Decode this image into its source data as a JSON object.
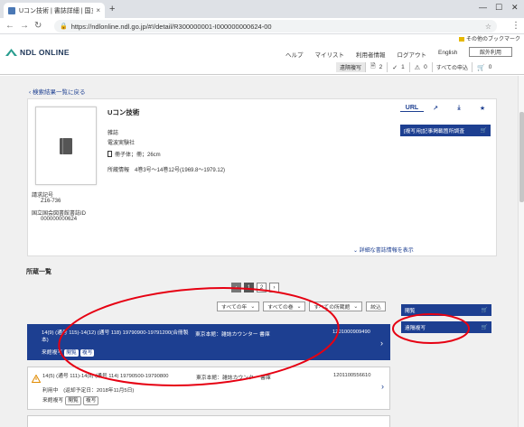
{
  "browser": {
    "tab_title": "Uコン技術 | 書誌詳細 | 国立国会",
    "tab_close": "×",
    "new_tab": "+",
    "url": "https://ndlonline.ndl.go.jp/#!/detail/R300000001-I000000000624-00",
    "bookmark_other": "その他のブックマーク",
    "win_min": "—",
    "win_max": "☐",
    "win_close": "✕"
  },
  "header": {
    "logo_text": "NDL ONLINE",
    "nav": [
      "ヘルプ",
      "マイリスト",
      "利用者情報",
      "ログアウト",
      "English"
    ],
    "remote_button": "館外利用",
    "copy_request": "遠隔複写",
    "copy_count": "2",
    "check_count": "1",
    "warn_count": "0",
    "all_requests": "すべての申込",
    "cart_count": "0"
  },
  "main": {
    "back_link": "検索結果一覧に戻る",
    "title": "Uコン技術",
    "type": "雑誌",
    "publisher": "電波実験社",
    "format": "冊子体；冊；26cm",
    "holdings_info": "所蔵情報　4巻3号～14巻12号(1969.8～1979.12)",
    "call_number_label": "請求記号",
    "call_number": "Z16-736",
    "bib_id_label": "国立国会図書館書誌ID",
    "bib_id": "000000000624",
    "more_link": "詳細な書誌情報を表示",
    "actions": {
      "url": "URL",
      "external": "↗",
      "download": "⤓",
      "star": "★"
    },
    "copy_survey": "[複写用]記事掲載箇所調査"
  },
  "holdings": {
    "label": "所蔵一覧",
    "pages": [
      "1",
      "2"
    ],
    "current_page": "1",
    "filters": [
      "すべての年",
      "すべての巻",
      "すべての所蔵館"
    ],
    "narrow_button": "絞込",
    "rows": [
      {
        "volume": "14(9) (通号 115)-14(12) (通号 118) 19790900-19791200(合冊製本)",
        "location": "東京本館：雑誌カウンター 書庫",
        "call_number": "1201000909490",
        "status_label": "来館複写",
        "tags": [
          "閲覧",
          "複写"
        ]
      },
      {
        "volume": "14(5) (通号 111)-14(8) (通号 114) 19790500-19790800",
        "location": "東京本館：雑誌カウンター 書庫",
        "call_number": "1201100556610",
        "status_label": "利用中　(返却予定日：2018年11月5日)",
        "status_line2": "来館複写",
        "tags": [
          "閲覧",
          "複写"
        ]
      },
      {
        "volume": "",
        "location": "",
        "call_number": ""
      }
    ],
    "side_buttons": [
      "閲覧",
      "遠隔複写"
    ]
  },
  "colors": {
    "primary": "#1d3f91",
    "annotation": "#e60012"
  }
}
